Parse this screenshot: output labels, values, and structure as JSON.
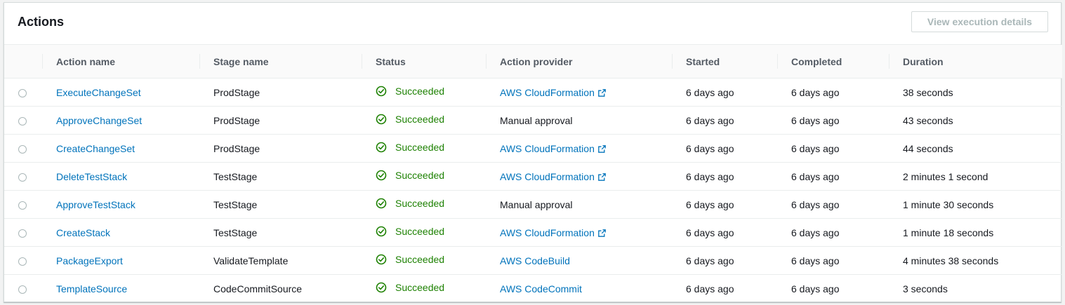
{
  "panel": {
    "title": "Actions",
    "view_button_label": "View execution details"
  },
  "columns": [
    "Action name",
    "Stage name",
    "Status",
    "Action provider",
    "Started",
    "Completed",
    "Duration"
  ],
  "rows": [
    {
      "action": "ExecuteChangeSet",
      "stage": "ProdStage",
      "status": "Succeeded",
      "provider": "AWS CloudFormation",
      "provider_link": true,
      "provider_external": true,
      "started": "6 days ago",
      "completed": "6 days ago",
      "duration": "38 seconds"
    },
    {
      "action": "ApproveChangeSet",
      "stage": "ProdStage",
      "status": "Succeeded",
      "provider": "Manual approval",
      "provider_link": false,
      "provider_external": false,
      "started": "6 days ago",
      "completed": "6 days ago",
      "duration": "43 seconds"
    },
    {
      "action": "CreateChangeSet",
      "stage": "ProdStage",
      "status": "Succeeded",
      "provider": "AWS CloudFormation",
      "provider_link": true,
      "provider_external": true,
      "started": "6 days ago",
      "completed": "6 days ago",
      "duration": "44 seconds"
    },
    {
      "action": "DeleteTestStack",
      "stage": "TestStage",
      "status": "Succeeded",
      "provider": "AWS CloudFormation",
      "provider_link": true,
      "provider_external": true,
      "started": "6 days ago",
      "completed": "6 days ago",
      "duration": "2 minutes 1 second"
    },
    {
      "action": "ApproveTestStack",
      "stage": "TestStage",
      "status": "Succeeded",
      "provider": "Manual approval",
      "provider_link": false,
      "provider_external": false,
      "started": "6 days ago",
      "completed": "6 days ago",
      "duration": "1 minute 30 seconds"
    },
    {
      "action": "CreateStack",
      "stage": "TestStage",
      "status": "Succeeded",
      "provider": "AWS CloudFormation",
      "provider_link": true,
      "provider_external": true,
      "started": "6 days ago",
      "completed": "6 days ago",
      "duration": "1 minute 18 seconds"
    },
    {
      "action": "PackageExport",
      "stage": "ValidateTemplate",
      "status": "Succeeded",
      "provider": "AWS CodeBuild",
      "provider_link": true,
      "provider_external": false,
      "started": "6 days ago",
      "completed": "6 days ago",
      "duration": "4 minutes 38 seconds"
    },
    {
      "action": "TemplateSource",
      "stage": "CodeCommitSource",
      "status": "Succeeded",
      "provider": "AWS CodeCommit",
      "provider_link": true,
      "provider_external": false,
      "started": "6 days ago",
      "completed": "6 days ago",
      "duration": "3 seconds"
    }
  ],
  "colors": {
    "link": "#0073bb",
    "success": "#1d8102",
    "header_text": "#545b64",
    "disabled_text": "#aab7b8"
  },
  "icons": {
    "status": "check-circle-icon",
    "external": "external-link-icon",
    "row_select": "radio-button"
  }
}
